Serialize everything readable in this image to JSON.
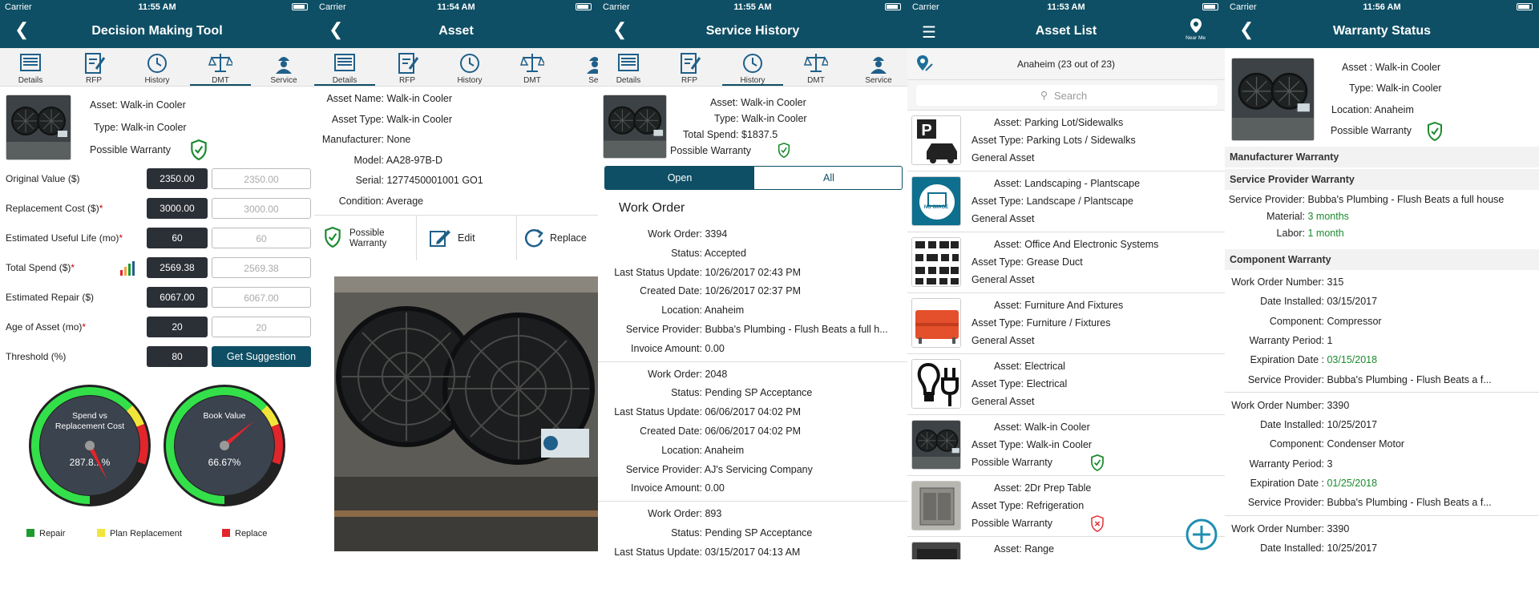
{
  "status": {
    "carrier": "Carrier"
  },
  "screen1": {
    "time": "11:55 AM",
    "title": "Decision Making Tool",
    "tabs": [
      "Details",
      "RFP",
      "History",
      "DMT",
      "Service"
    ],
    "asset_label": "Asset:",
    "asset": "Walk-in Cooler",
    "type_label": "Type:",
    "type": "Walk-in Cooler",
    "warranty": "Possible Warranty",
    "fields": [
      {
        "label": "Original Value ($)",
        "req": "",
        "value": "2350.00",
        "placeholder": "2350.00"
      },
      {
        "label": "Replacement Cost ($)",
        "req": "*",
        "value": "3000.00",
        "placeholder": "3000.00"
      },
      {
        "label": "Estimated Useful Life (mo)",
        "req": "*",
        "value": "60",
        "placeholder": "60"
      },
      {
        "label": "Total Spend ($)",
        "req": "*",
        "value": "2569.38",
        "placeholder": "2569.38"
      },
      {
        "label": "Estimated Repair ($)",
        "req": "",
        "value": "6067.00",
        "placeholder": "6067.00"
      },
      {
        "label": "Age of Asset (mo)",
        "req": "*",
        "value": "20",
        "placeholder": "20"
      },
      {
        "label": "Threshold (%)",
        "req": "",
        "value": "80",
        "placeholder": ""
      }
    ],
    "get_suggestion": "Get Suggestion",
    "gauge1": {
      "title1": "Spend vs",
      "title2": "Replacement Cost",
      "value": "287.8...%",
      "level": 2.878
    },
    "gauge2": {
      "title1": "Book Value",
      "value": "66.67%",
      "level": 0.6667
    },
    "legend": [
      {
        "label": "Repair",
        "color": "#1e9b2e"
      },
      {
        "label": "Plan Replacement",
        "color": "#f2e53a"
      },
      {
        "label": "Replace",
        "color": "#e2252b"
      }
    ]
  },
  "screen2": {
    "time": "11:54 AM",
    "title": "Asset",
    "tabs": [
      "Details",
      "RFP",
      "History",
      "DMT",
      "Ser"
    ],
    "fields": [
      {
        "k": "Asset Name:",
        "v": "Walk-in Cooler"
      },
      {
        "k": "Asset Type:",
        "v": "Walk-in Cooler"
      },
      {
        "k": "Manufacturer:",
        "v": "None"
      },
      {
        "k": "Model:",
        "v": "AA28-97B-D"
      },
      {
        "k": "Serial:",
        "v": "1277450001001 GO1"
      },
      {
        "k": "Condition:",
        "v": "Average"
      }
    ],
    "actions": {
      "warranty1": "Possible",
      "warranty2": "Warranty",
      "edit": "Edit",
      "replace": "Replace"
    }
  },
  "screen3": {
    "time": "11:55 AM",
    "title": "Service History",
    "tabs": [
      "Details",
      "RFP",
      "History",
      "DMT",
      "Service"
    ],
    "asset_label": "Asset:",
    "asset": "Walk-in Cooler",
    "type_label": "Type:",
    "type": "Walk-in Cooler",
    "spend_label": "Total Spend:",
    "spend": "$1837.5",
    "warranty": "Possible Warranty",
    "seg": {
      "open": "Open",
      "all": "All"
    },
    "heading": "Work Order",
    "orders": [
      [
        {
          "k": "Work Order:",
          "v": "3394"
        },
        {
          "k": "Status:",
          "v": "Accepted"
        },
        {
          "k": "Last Status Update:",
          "v": "10/26/2017 02:43 PM"
        },
        {
          "k": "Created Date:",
          "v": "10/26/2017 02:37 PM"
        },
        {
          "k": "Location:",
          "v": "Anaheim"
        },
        {
          "k": "Service Provider:",
          "v": "Bubba's Plumbing - Flush Beats a full h..."
        },
        {
          "k": "Invoice Amount:",
          "v": "0.00"
        }
      ],
      [
        {
          "k": "Work Order:",
          "v": "2048"
        },
        {
          "k": "Status:",
          "v": "Pending SP Acceptance"
        },
        {
          "k": "Last Status Update:",
          "v": "06/06/2017 04:02 PM"
        },
        {
          "k": "Created Date:",
          "v": "06/06/2017 04:02 PM"
        },
        {
          "k": "Location:",
          "v": "Anaheim"
        },
        {
          "k": "Service Provider:",
          "v": "AJ's Servicing Company"
        },
        {
          "k": "Invoice Amount:",
          "v": "0.00"
        }
      ],
      [
        {
          "k": "Work Order:",
          "v": "893"
        },
        {
          "k": "Status:",
          "v": "Pending SP Acceptance"
        },
        {
          "k": "Last Status Update:",
          "v": "03/15/2017 04:13 AM"
        }
      ]
    ]
  },
  "screen4": {
    "time": "11:53 AM",
    "title": "Asset List",
    "near_me": "Near Me",
    "location": "Anaheim (23 out of 23)",
    "search_placeholder": "Search",
    "asset_label": "Asset:",
    "type_label": "Asset Type:",
    "items": [
      {
        "asset": "Parking Lot/Sidewalks",
        "type": "Parking Lots / Sidewalks",
        "sub": "General Asset",
        "icon": "parking-icon",
        "shield": ""
      },
      {
        "asset": "Landscaping - Plantscape",
        "type": "Landscape / Plantscape",
        "sub": "General Asset",
        "icon": "no-image-icon",
        "shield": "",
        "no_image": "NO IMAGE"
      },
      {
        "asset": "Office And Electronic Systems",
        "type": "Grease Duct",
        "sub": "General Asset",
        "icon": "electronics-icon",
        "shield": ""
      },
      {
        "asset": "Furniture And Fixtures",
        "type": "Furniture / Fixtures",
        "sub": "General Asset",
        "icon": "sofa-icon",
        "shield": ""
      },
      {
        "asset": "Electrical",
        "type": "Electrical",
        "sub": "General Asset",
        "icon": "bulb-plug-icon",
        "shield": ""
      },
      {
        "asset": "Walk-in Cooler",
        "type": "Walk-in Cooler",
        "sub": "Possible Warranty",
        "icon": "cooler-icon",
        "shield": "green"
      },
      {
        "asset": "2Dr Prep Table",
        "type": "Refrigeration",
        "sub": "Possible Warranty",
        "icon": "prep-table-icon",
        "shield": "red"
      },
      {
        "asset": "Range",
        "type": "",
        "sub": "",
        "icon": "range-icon",
        "shield": ""
      }
    ]
  },
  "screen5": {
    "time": "11:56 AM",
    "title": "Warranty Status",
    "asset_label": "Asset :",
    "asset": "Walk-in Cooler",
    "type_label": "Type:",
    "type": "Walk-in Cooler",
    "location_label": "Location:",
    "location": "Anaheim",
    "warranty": "Possible Warranty",
    "manufacturer_head": "Manufacturer Warranty",
    "sp_head": "Service Provider Warranty",
    "sp": [
      {
        "k": "Service Provider:",
        "v": "Bubba's Plumbing - Flush Beats a full house"
      },
      {
        "k": "Material:",
        "v": "3 months"
      },
      {
        "k": "Labor:",
        "v": "1 month"
      }
    ],
    "component_head": "Component Warranty",
    "components": [
      [
        {
          "k": "Work Order Number:",
          "v": "315"
        },
        {
          "k": "Date Installed:",
          "v": "03/15/2017"
        },
        {
          "k": "Component:",
          "v": "Compressor"
        },
        {
          "k": "Warranty Period:",
          "v": "1"
        },
        {
          "k": "Expiration Date :",
          "v": "03/15/2018"
        },
        {
          "k": "Service Provider:",
          "v": "Bubba's Plumbing - Flush Beats a f..."
        }
      ],
      [
        {
          "k": "Work Order Number:",
          "v": "3390"
        },
        {
          "k": "Date Installed:",
          "v": "10/25/2017"
        },
        {
          "k": "Component:",
          "v": "Condenser Motor"
        },
        {
          "k": "Warranty Period:",
          "v": "3"
        },
        {
          "k": "Expiration Date :",
          "v": "01/25/2018"
        },
        {
          "k": "Service Provider:",
          "v": "Bubba's Plumbing - Flush Beats a f..."
        }
      ],
      [
        {
          "k": "Work Order Number:",
          "v": "3390"
        },
        {
          "k": "Date Installed:",
          "v": "10/25/2017"
        }
      ]
    ]
  },
  "colors": {
    "primary": "#0e4f65",
    "green": "#1b8a2e",
    "red": "#e2252b"
  }
}
